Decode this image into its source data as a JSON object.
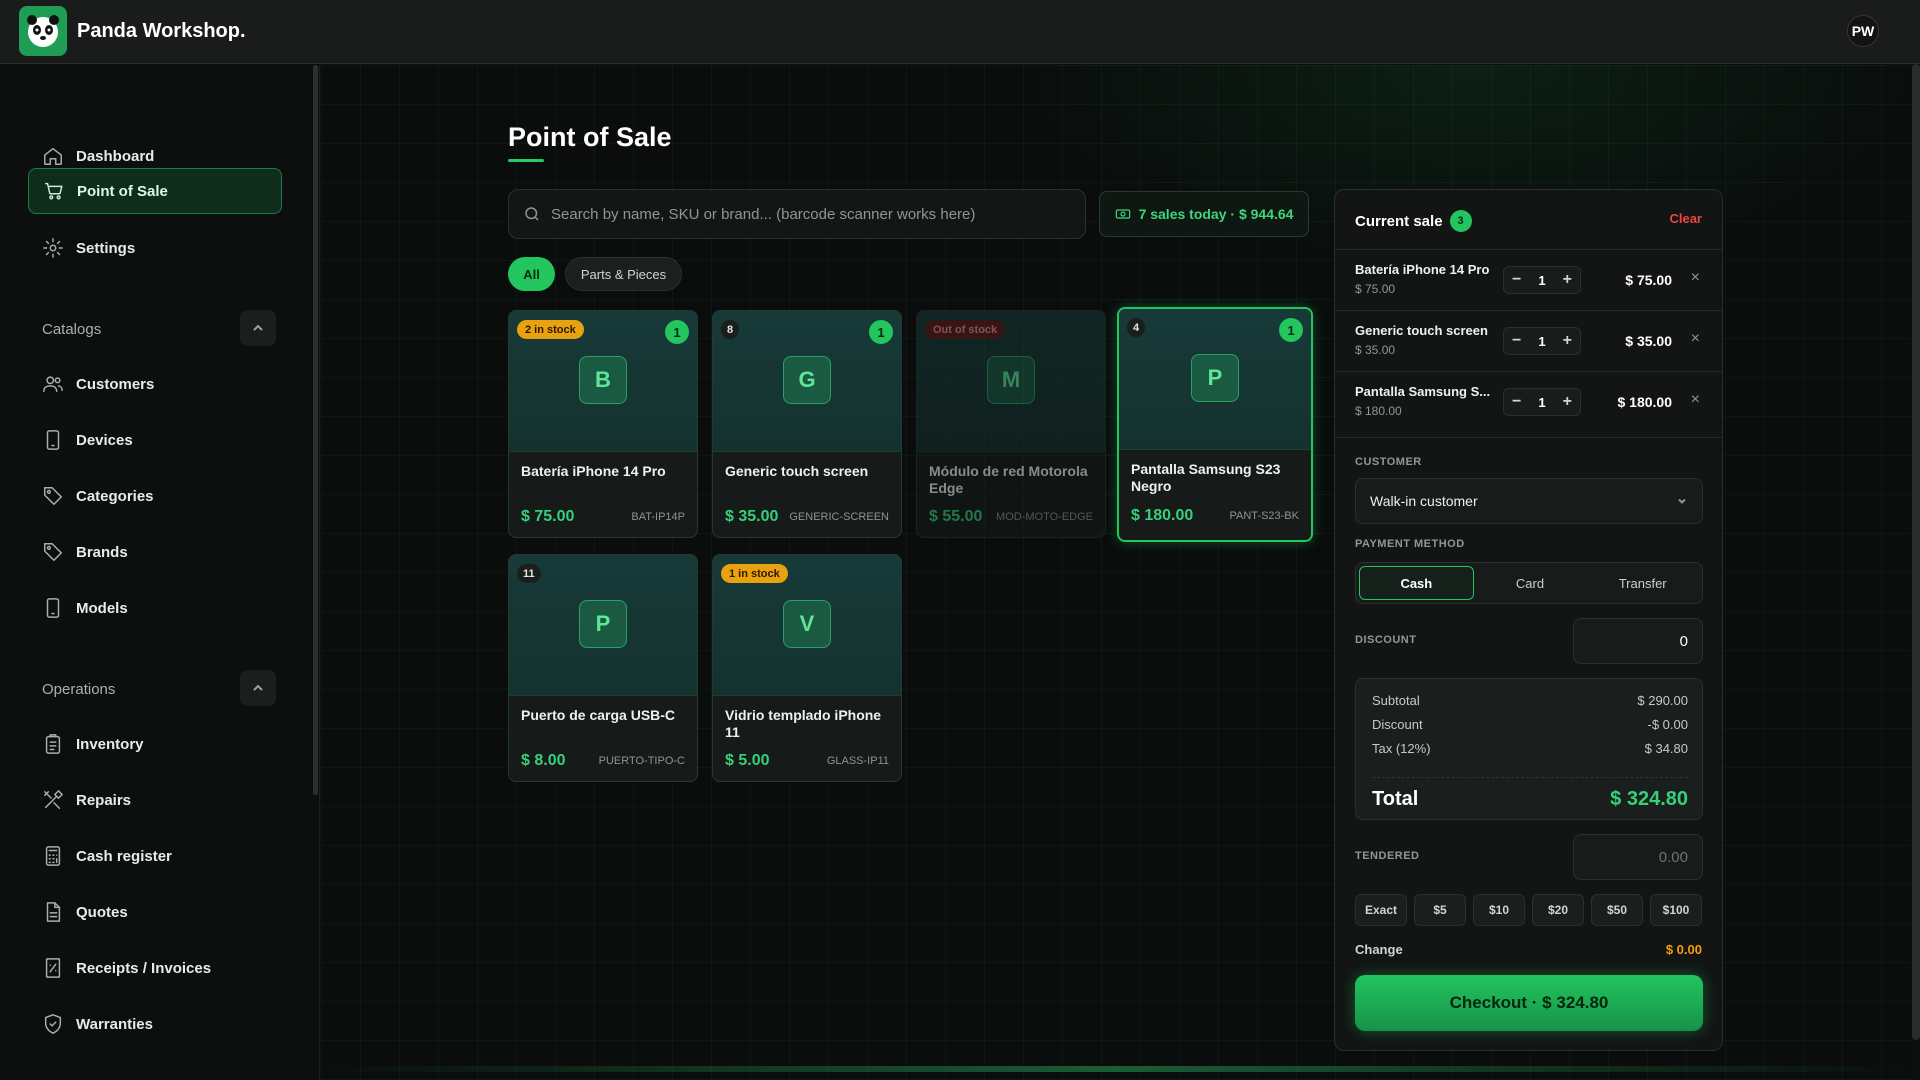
{
  "app": {
    "brand": "Panda Workshop.",
    "user_initials": "PW"
  },
  "sidebar": {
    "items": [
      {
        "label": "Dashboard",
        "icon": "home-icon"
      },
      {
        "label": "Point of Sale",
        "icon": "cart-icon",
        "active": true
      },
      {
        "label": "Settings",
        "icon": "gear-icon"
      }
    ],
    "catalogs_title": "Catalogs",
    "catalogs": [
      {
        "label": "Customers",
        "icon": "users-icon"
      },
      {
        "label": "Devices",
        "icon": "phone-icon"
      },
      {
        "label": "Categories",
        "icon": "tag-icon"
      },
      {
        "label": "Brands",
        "icon": "tag-icon"
      },
      {
        "label": "Models",
        "icon": "phone-icon"
      }
    ],
    "operations_title": "Operations",
    "operations": [
      {
        "label": "Inventory",
        "icon": "clipboard-icon"
      },
      {
        "label": "Repairs",
        "icon": "tools-icon"
      },
      {
        "label": "Cash register",
        "icon": "calculator-icon"
      },
      {
        "label": "Quotes",
        "icon": "document-icon"
      },
      {
        "label": "Receipts / Invoices",
        "icon": "receipt-icon"
      },
      {
        "label": "Warranties",
        "icon": "shield-icon"
      }
    ]
  },
  "main": {
    "title": "Point of Sale",
    "search_placeholder": "Search by name, SKU or brand... (barcode scanner works here)",
    "stats": "7 sales today · $ 944.64",
    "filters": [
      "All",
      "Parts & Pieces"
    ],
    "products": [
      {
        "badge": "2 in stock",
        "count": "1",
        "letter": "B",
        "name": "Batería iPhone 14 Pro",
        "price": "$ 75.00",
        "sku": "BAT-IP14P"
      },
      {
        "badge": "8",
        "count": "1",
        "letter": "G",
        "name": "Generic touch screen",
        "price": "$ 35.00",
        "sku": "GENERIC-SCREEN"
      },
      {
        "badge": "Out of stock",
        "count": "",
        "letter": "M",
        "name": "Módulo de red Motorola Edge",
        "price": "$ 55.00",
        "sku": "MOD-MOTO-EDGE"
      },
      {
        "badge": "4",
        "count": "1",
        "letter": "P",
        "name": "Pantalla Samsung S23 Negro",
        "price": "$ 180.00",
        "sku": "PANT-S23-BK"
      },
      {
        "badge": "11",
        "count": "",
        "letter": "P",
        "name": "Puerto de carga USB-C",
        "price": "$ 8.00",
        "sku": "PUERTO-TIPO-C"
      },
      {
        "badge": "1 in stock",
        "count": "",
        "letter": "V",
        "name": "Vidrio templado iPhone 11",
        "price": "$ 5.00",
        "sku": "GLASS-IP11"
      }
    ]
  },
  "cart": {
    "title": "Current sale",
    "count": "3",
    "clear_label": "Clear",
    "lines": [
      {
        "name": "Batería iPhone 14 Pro",
        "unit": "$ 75.00",
        "qty": "1",
        "total": "$ 75.00"
      },
      {
        "name": "Generic touch screen",
        "unit": "$ 35.00",
        "qty": "1",
        "total": "$ 35.00"
      },
      {
        "name": "Pantalla Samsung S...",
        "unit": "$ 180.00",
        "qty": "1",
        "total": "$ 180.00"
      }
    ],
    "minus": "−",
    "plus": "+",
    "remove": "×",
    "customer_label": "CUSTOMER",
    "customer_value": "Walk-in customer",
    "payment_label": "PAYMENT METHOD",
    "payment_methods": [
      "Cash",
      "Card",
      "Transfer"
    ],
    "discount_label": "DISCOUNT",
    "discount_value": "0",
    "summary": {
      "subtotal_label": "Subtotal",
      "subtotal": "$ 290.00",
      "discount_label": "Discount",
      "discount": "-$ 0.00",
      "tax_label": "Tax (12%)",
      "tax": "$ 34.80",
      "total_label": "Total",
      "total": "$ 324.80"
    },
    "tendered_label": "TENDERED",
    "tendered_placeholder": "0.00",
    "quick_amounts": [
      "Exact",
      "$5",
      "$10",
      "$20",
      "$50",
      "$100"
    ],
    "change_label": "Change",
    "change_value": "$ 0.00",
    "checkout_label": "Checkout · $ 324.80"
  }
}
